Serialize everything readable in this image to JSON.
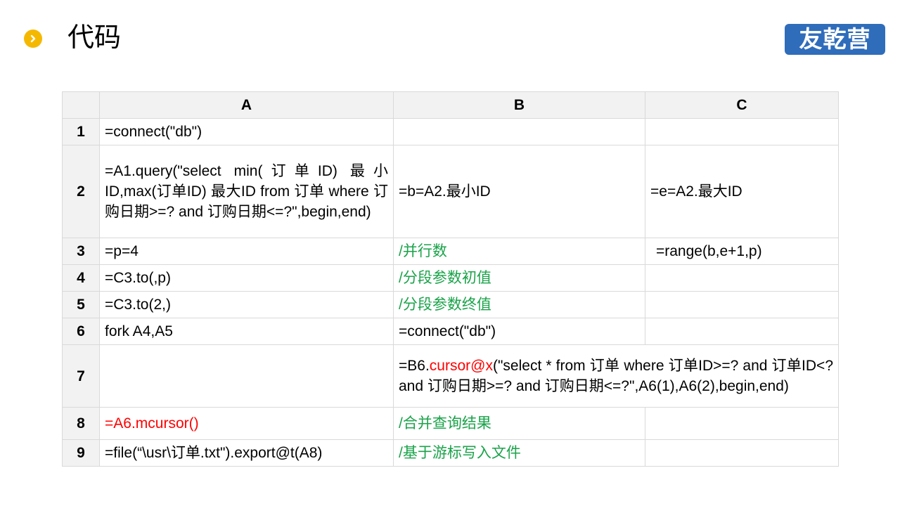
{
  "header": {
    "title": "代码",
    "bullet_icon": "chevron-right-icon",
    "logo_text": "友乾营"
  },
  "colors": {
    "bullet": "#f5b800",
    "logo_bg": "#2f6dbb",
    "comment_green": "#1aa34a",
    "highlight_red": "#ff0000",
    "header_bg": "#f2f2f2",
    "grid": "#d9d9d9"
  },
  "sheet": {
    "columns": [
      "A",
      "B",
      "C"
    ],
    "rows": [
      {
        "num": "1",
        "a": "=connect(\"db\")",
        "b": "",
        "c": ""
      },
      {
        "num": "2",
        "a": "=A1.query(\"select min(订单ID) 最小ID,max(订单ID) 最大ID from 订单 where 订购日期>=? and 订购日期<=?\",begin,end)",
        "b": "=b=A2.最小ID",
        "c": "=e=A2.最大ID"
      },
      {
        "num": "3",
        "a": "=p=4",
        "b": "/并行数",
        "c": "=range(b,e+1,p)"
      },
      {
        "num": "4",
        "a": "=C3.to(,p)",
        "b": "/分段参数初值",
        "c": ""
      },
      {
        "num": "5",
        "a": "=C3.to(2,)",
        "b": "/分段参数终值",
        "c": ""
      },
      {
        "num": "6",
        "a": "fork A4,A5",
        "b": "=connect(\"db\")",
        "c": ""
      },
      {
        "num": "7",
        "a": "",
        "b_prefix": "=B6.",
        "b_highlight": "cursor@x",
        "b_rest": "(\"select * from 订单 where 订单ID>=? and 订单ID<? and 订购日期>=? and 订购日期<=?\",A6(1),A6(2),begin,end)"
      },
      {
        "num": "8",
        "a": "=A6.mcursor()",
        "b": "/合并查询结果",
        "c": ""
      },
      {
        "num": "9",
        "a": "=file(“\\usr\\订单.txt\").export@t(A8)",
        "b": "/基于游标写入文件",
        "c": ""
      }
    ]
  }
}
